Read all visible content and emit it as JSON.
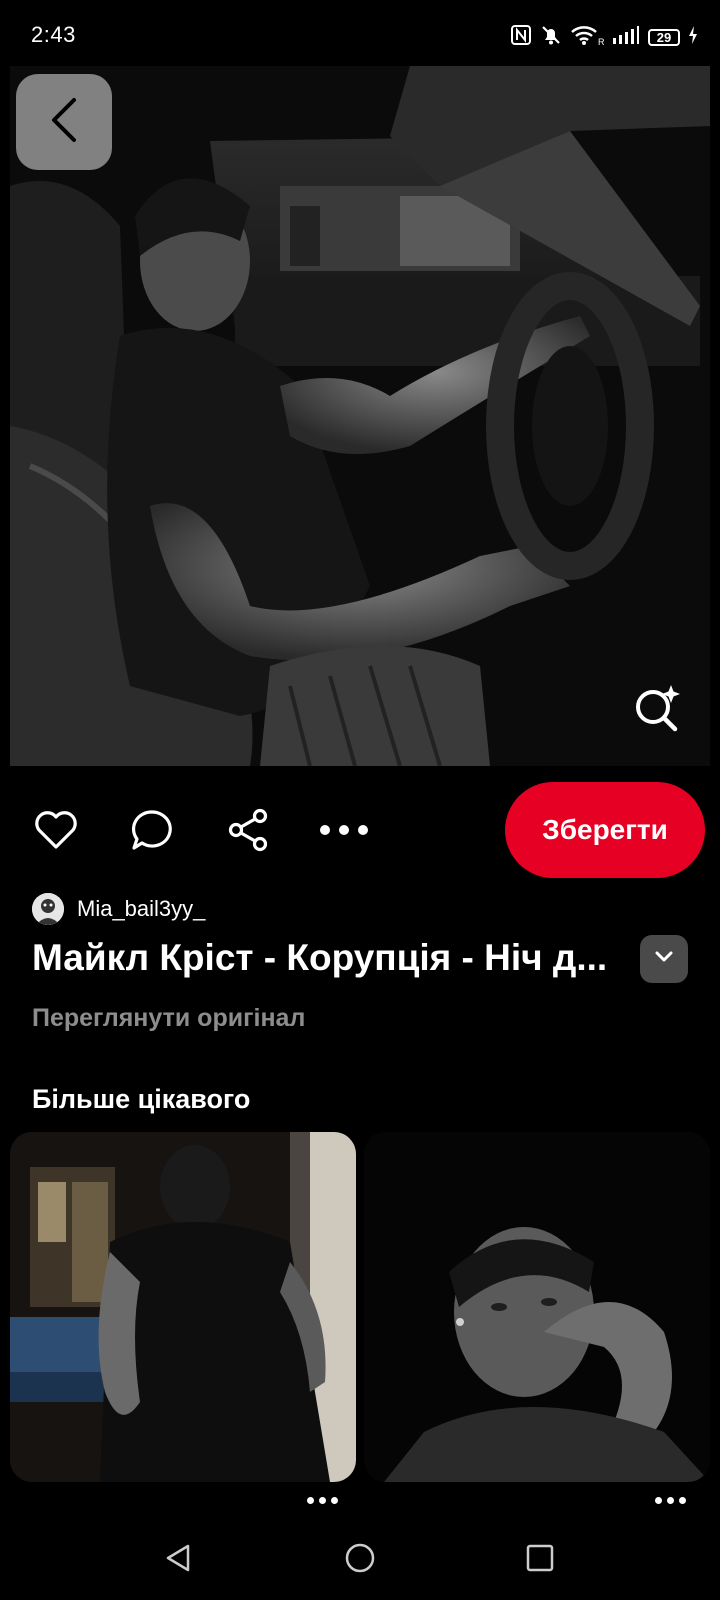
{
  "status_bar": {
    "time": "2:43",
    "battery": "29",
    "icons": [
      "nfc-icon",
      "mute-icon",
      "wifi-icon",
      "signal-icon",
      "battery-icon",
      "charging-icon"
    ]
  },
  "pin": {
    "author": "Mia_bail3yy_",
    "title": "Майкл Кріст - Корупція - Ніч д...",
    "view_original": "Переглянути оригінал"
  },
  "actions": {
    "save_label": "Зберегти",
    "icons": [
      "heart-icon",
      "comment-icon",
      "share-icon",
      "more-icon"
    ]
  },
  "more": {
    "heading": "Більше цікавого"
  },
  "colors": {
    "background": "#000000",
    "accent": "#e60023",
    "muted_text": "#8d8d8d",
    "back_button": "#8c8c8c"
  }
}
